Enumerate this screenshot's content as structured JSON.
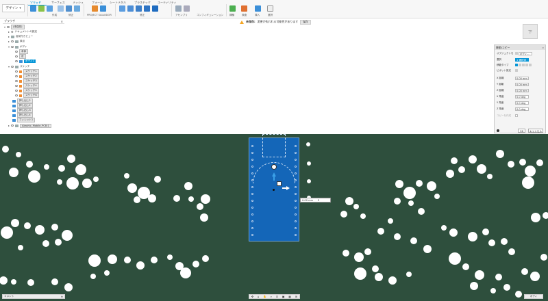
{
  "toolbar": {
    "workspace": "デザイン",
    "tabs": [
      "ソリッド",
      "サーフェス",
      "メッシュ",
      "フォーム",
      "シートメタル",
      "プラスチック",
      "ユーティリティ"
    ],
    "active_tab": "ソリッド",
    "groups": [
      "作成",
      "修正",
      "PROJECT SALVADOR",
      "修正",
      "アセンブリ",
      "コンフィギュレーション",
      "構築",
      "検査",
      "挿入",
      "選択"
    ]
  },
  "warning": {
    "label": "未保存:",
    "message": "変更が失われる可能性があります",
    "button": "保存"
  },
  "browser": {
    "title": "ブラウザ",
    "root": "(未保存)",
    "items": [
      {
        "label": "ドキュメントの設定",
        "type": "gear"
      },
      {
        "label": "名前付きビュー",
        "type": "folder"
      },
      {
        "label": "原点",
        "type": "folder"
      },
      {
        "label": "ボディ",
        "type": "folder",
        "open": true
      },
      {
        "label": "本体",
        "type": "body"
      },
      {
        "label": "台",
        "type": "body"
      },
      {
        "label": "ボディ1",
        "type": "body",
        "selected": true
      },
      {
        "label": "スケッチ",
        "type": "folder",
        "open": true
      },
      {
        "label": "スケッチ1",
        "type": "sketch"
      },
      {
        "label": "スケッチ2",
        "type": "sketch"
      },
      {
        "label": "スケッチ3",
        "type": "sketch"
      },
      {
        "label": "スケッチ4",
        "type": "sketch"
      },
      {
        "label": "スケッチ5",
        "type": "sketch"
      },
      {
        "label": "スケッチ6",
        "type": "sketch"
      },
      {
        "label": "押し出し2",
        "type": "body"
      },
      {
        "label": "押し出し2",
        "type": "body"
      },
      {
        "label": "押し出し3",
        "type": "body"
      },
      {
        "label": "押し出し4",
        "type": "body"
      },
      {
        "label": "フィレット1",
        "type": "body"
      },
      {
        "label": "Akashic_Mobile_PCB:1",
        "type": "component"
      }
    ]
  },
  "viewcube": {
    "face": "下"
  },
  "move_dialog": {
    "title": "移動/コピー",
    "rows": [
      {
        "label": "オブジェクトを",
        "value": "ボディ..."
      },
      {
        "label": "選択",
        "value": "1 選択済み"
      },
      {
        "label": "移動タイプ",
        "value": ""
      },
      {
        "label": "ピボット設定",
        "value": ""
      },
      {
        "label": "X 距離",
        "value": "0.00 mm"
      },
      {
        "label": "Y 距離",
        "value": "0.00 mm"
      },
      {
        "label": "Z 距離",
        "value": "0.00 mm"
      },
      {
        "label": "X 角度",
        "value": "0.0 deg"
      },
      {
        "label": "Y 角度",
        "value": "0.0 deg"
      },
      {
        "label": "Z 角度",
        "value": "0.0 deg"
      },
      {
        "label": "コピーを作成",
        "value": ""
      }
    ],
    "ok": "OK",
    "cancel": "キャンセル"
  },
  "canvas": {
    "distance_readout": "0.00 mm"
  },
  "status": {
    "comments": "コメント",
    "view_badge": "ボディ"
  },
  "colors": {
    "accent": "#0696d7",
    "board": "#2e4f3d",
    "module": "#1466b8"
  }
}
